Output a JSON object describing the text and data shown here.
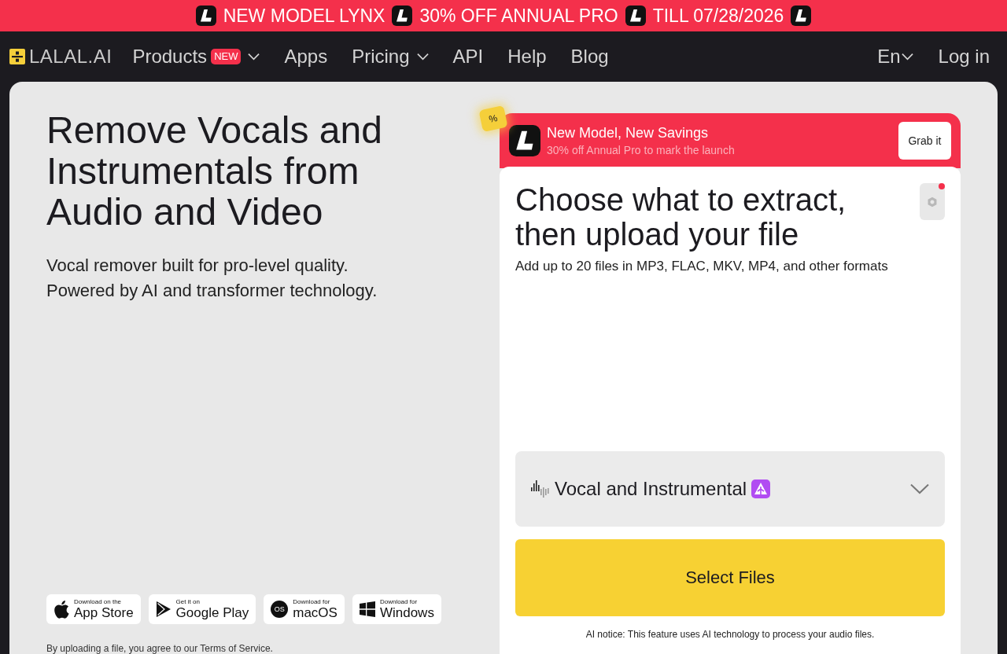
{
  "promo_banner": {
    "segments": [
      "NEW MODEL LYNX",
      "30% OFF ANNUAL PRO",
      "TILL 07/28/2026"
    ]
  },
  "nav": {
    "logo": "LALAL.AI",
    "items": [
      {
        "label": "Products",
        "badge": "NEW",
        "has_menu": true
      },
      {
        "label": "Apps",
        "has_menu": false
      },
      {
        "label": "Pricing",
        "has_menu": true
      },
      {
        "label": "API",
        "has_menu": false
      },
      {
        "label": "Help",
        "has_menu": false
      },
      {
        "label": "Blog",
        "has_menu": false
      }
    ],
    "language": "En",
    "login": "Log in"
  },
  "hero": {
    "title_lines": [
      "Remove Vocals and",
      "Instrumentals from",
      "Audio and Video"
    ],
    "subtitle_lines": [
      "Vocal remover built for pro-level quality.",
      "Powered by AI and transformer technology."
    ],
    "store_buttons": [
      {
        "kind": "apple",
        "caption": "Download on the",
        "name": "App Store"
      },
      {
        "kind": "google_play",
        "caption": "Get it on",
        "name": "Google Play"
      },
      {
        "kind": "macos",
        "caption": "Download for",
        "name": "macOS",
        "logo_text": "OS"
      },
      {
        "kind": "windows",
        "caption": "Download for",
        "name": "Windows"
      }
    ],
    "terms": "By uploading a file, you agree to our Terms of Service."
  },
  "offer": {
    "tag": "%",
    "title": "New Model, New Savings",
    "subtitle": "30% off Annual Pro to mark the launch",
    "button": "Grab it"
  },
  "uploader": {
    "title_lines": [
      "Choose what to extract,",
      "then upload your file"
    ],
    "subtitle": "Add up to 20 files in MP3, FLAC, MKV, MP4, and other formats",
    "settings_notification": true,
    "stem_select": {
      "value": "Vocal and Instrumental"
    },
    "button": "Select Files",
    "notice": "AI notice: This feature uses AI technology to process your audio files."
  }
}
